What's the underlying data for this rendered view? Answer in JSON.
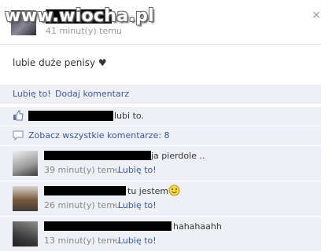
{
  "watermark": "www.wiocha.pl",
  "post": {
    "time": "41 minut(y) temu",
    "status": "lubie duże penisy ♥"
  },
  "actions": {
    "like": "Lubię to!",
    "separator": "·",
    "comment": "Dodaj komentarz"
  },
  "likes": {
    "suffix": "lubi to."
  },
  "view_all": "Zobacz wszystkie komentarze: 8",
  "comments": [
    {
      "text": "ja pierdole ..",
      "time": "39 minut(y) temu",
      "like": "Lubię to!"
    },
    {
      "text": "tu jestem",
      "time": "26 minut(y) temu",
      "like": "Lubię to!"
    },
    {
      "text": "hahahaahh",
      "time": "13 minut(y) temu",
      "like": "Lubię to!"
    }
  ],
  "icons": {
    "close": "close-icon",
    "like": "thumbs-up-icon",
    "comments": "comment-bubble-icon",
    "smiley": "smiley-icon"
  },
  "colors": {
    "link": "#3b5998",
    "panel": "#eef0f5"
  }
}
